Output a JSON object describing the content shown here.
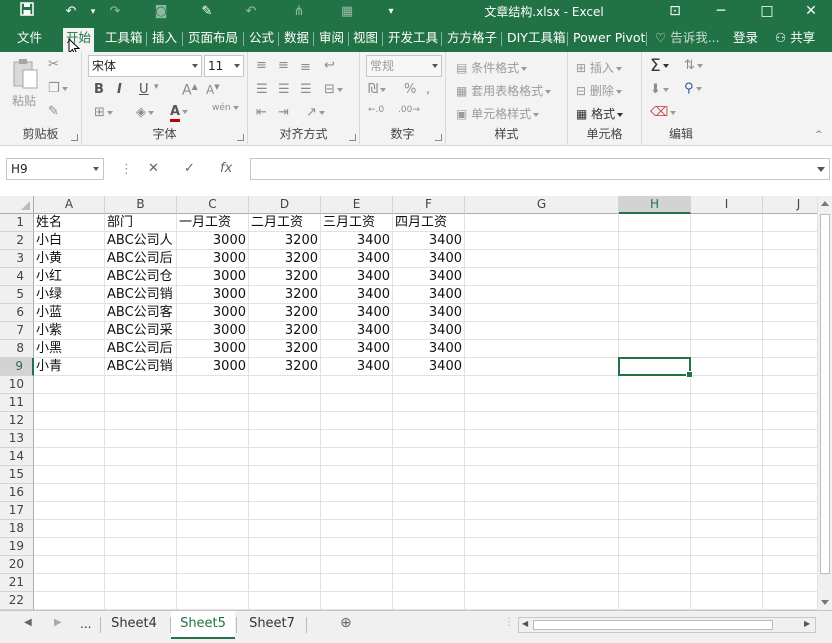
{
  "window": {
    "title": "文章结构.xlsx - Excel",
    "brand_color": "#217346"
  },
  "quick_access": [
    "save-icon",
    "undo-icon",
    "redo-icon",
    "camera-icon",
    "format-painter-icon",
    "undo-icon",
    "tree-icon",
    "grid-icon",
    "customize-icon"
  ],
  "menu_tabs": [
    {
      "label": "文件"
    },
    {
      "label": "开始",
      "active": true
    },
    {
      "label": "工具箱"
    },
    {
      "label": "插入"
    },
    {
      "label": "页面布局"
    },
    {
      "label": "公式"
    },
    {
      "label": "数据"
    },
    {
      "label": "审阅"
    },
    {
      "label": "视图"
    },
    {
      "label": "开发工具"
    },
    {
      "label": "方方格子"
    },
    {
      "label": "DIY工具箱"
    },
    {
      "label": "Power Pivot"
    }
  ],
  "tell_me": "告诉我...",
  "login": "登录",
  "share": "共享",
  "ribbon": {
    "paste_label": "粘贴",
    "clipboard_label": "剪贴板",
    "font_name": "宋体",
    "font_size": "11",
    "font_label": "字体",
    "align_label": "对齐方式",
    "number_format": "常规",
    "number_label": "数字",
    "cond_format": "条件格式",
    "table_format": "套用表格格式",
    "cell_style": "单元格样式",
    "styles_label": "样式",
    "insert": "插入",
    "delete": "删除",
    "format": "格式",
    "cells_label": "单元格",
    "edit_label": "编辑",
    "bold": "B",
    "italic": "I",
    "underline": "U",
    "font_color": "A",
    "pinyin": "wén"
  },
  "formula_bar": {
    "name_box": "H9",
    "fx": "fx",
    "formula": ""
  },
  "grid": {
    "columns": [
      "A",
      "B",
      "C",
      "D",
      "E",
      "F",
      "G",
      "H",
      "I",
      "J"
    ],
    "selected_column": "H",
    "selected_row": 9,
    "rows": [
      [
        "姓名",
        "部门",
        "一月工资",
        "二月工资",
        "三月工资",
        "四月工资"
      ],
      [
        "小白",
        "ABC公司人",
        "3000",
        "3200",
        "3400",
        "3400"
      ],
      [
        "小黄",
        "ABC公司后",
        "3000",
        "3200",
        "3400",
        "3400"
      ],
      [
        "小红",
        "ABC公司仓",
        "3000",
        "3200",
        "3400",
        "3400"
      ],
      [
        "小绿",
        "ABC公司销",
        "3000",
        "3200",
        "3400",
        "3400"
      ],
      [
        "小蓝",
        "ABC公司客",
        "3000",
        "3200",
        "3400",
        "3400"
      ],
      [
        "小紫",
        "ABC公司采",
        "3000",
        "3200",
        "3400",
        "3400"
      ],
      [
        "小黑",
        "ABC公司后",
        "3000",
        "3200",
        "3400",
        "3400"
      ],
      [
        "小青",
        "ABC公司销",
        "3000",
        "3200",
        "3400",
        "3400"
      ]
    ],
    "row_count": 22
  },
  "sheets": {
    "ellipsis": "...",
    "tabs": [
      {
        "label": "Sheet4"
      },
      {
        "label": "Sheet5",
        "active": true
      },
      {
        "label": "Sheet7"
      }
    ],
    "add_icon": "plus-circle-icon"
  }
}
